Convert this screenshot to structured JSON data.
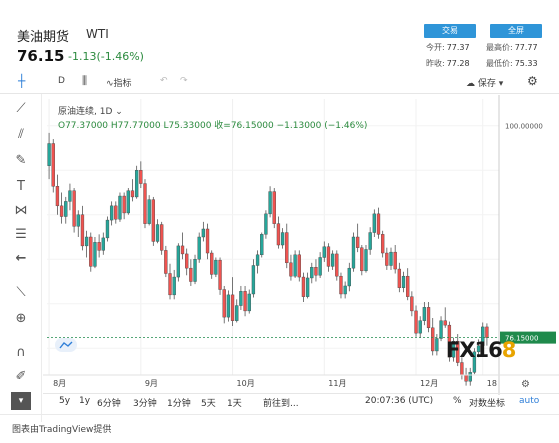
{
  "header": {
    "name": "美油期货",
    "symbol": "WTI",
    "price": "76.15",
    "change": "-1.13(-1.46%)",
    "trade_label": "交易",
    "fullscreen_label": "全屏",
    "stats": [
      {
        "label": "今开:",
        "value": "77.37"
      },
      {
        "label": "最高价:",
        "value": "77.77"
      },
      {
        "label": "昨收:",
        "value": "77.28"
      },
      {
        "label": "最低价:",
        "value": "75.33"
      }
    ]
  },
  "toolbar": {
    "interval": "D",
    "indicators_label": "指标",
    "save_label": "保存"
  },
  "legend": {
    "series": "原油连续, 1D",
    "ohlc": "O77.37000  H77.77000  L75.33000  收=76.15000  −1.13000 (−1.46%)"
  },
  "watermark": {
    "text_a": "FX16",
    "text_b": "8"
  },
  "bottom_bar": {
    "ranges": [
      "5y",
      "1y",
      "6分钟",
      "3分钟",
      "1分钟",
      "5天",
      "1天"
    ],
    "goto_label": "前往到...",
    "time": "20:07:36 (UTC)",
    "percent_label": "%",
    "log_label": "对数坐标",
    "auto_label": "auto"
  },
  "footer": {
    "text": "图表由TradingView提供"
  },
  "colors": {
    "up": "#26a69a",
    "down": "#ef5350",
    "line": "#1f8a4c",
    "accent": "#2f95d8"
  },
  "chart_data": {
    "type": "candlestick",
    "title": "原油连续, 1D",
    "x_tick_labels": [
      "8月",
      "9月",
      "10月",
      "11月",
      "12月",
      "18"
    ],
    "y_tick_labels": [
      "100.00000"
    ],
    "last_price_label": "76.15000",
    "ylim": [
      72,
      103
    ],
    "grid": true,
    "series": [
      {
        "name": "原油连续",
        "values": [
          [
            95.5,
            99.2,
            94.0,
            98.0
          ],
          [
            98.0,
            98.5,
            92.5,
            93.2
          ],
          [
            93.2,
            94.5,
            90.0,
            91.0
          ],
          [
            91.0,
            92.5,
            89.0,
            89.8
          ],
          [
            89.8,
            92.0,
            89.0,
            91.5
          ],
          [
            91.5,
            93.5,
            90.5,
            92.7
          ],
          [
            92.7,
            93.0,
            88.0,
            88.7
          ],
          [
            88.7,
            90.5,
            87.5,
            90.0
          ],
          [
            90.0,
            91.0,
            86.0,
            86.5
          ],
          [
            86.5,
            88.2,
            85.2,
            87.5
          ],
          [
            87.5,
            88.0,
            83.6,
            84.2
          ],
          [
            84.2,
            87.5,
            84.0,
            86.9
          ],
          [
            86.9,
            87.8,
            85.2,
            86.0
          ],
          [
            86.0,
            88.0,
            85.5,
            87.4
          ],
          [
            87.4,
            89.8,
            87.0,
            89.4
          ],
          [
            89.4,
            91.5,
            88.8,
            91.0
          ],
          [
            91.0,
            91.5,
            89.0,
            89.5
          ],
          [
            89.5,
            92.5,
            89.2,
            92.1
          ],
          [
            92.1,
            92.5,
            89.5,
            90.2
          ],
          [
            90.2,
            93.0,
            90.0,
            92.7
          ],
          [
            92.7,
            94.0,
            91.5,
            92.0
          ],
          [
            92.0,
            95.5,
            91.8,
            95.0
          ],
          [
            95.0,
            96.0,
            93.0,
            93.5
          ],
          [
            93.5,
            94.0,
            88.5,
            89.0
          ],
          [
            89.0,
            92.2,
            88.8,
            91.7
          ],
          [
            91.7,
            92.0,
            86.5,
            87.0
          ],
          [
            87.0,
            89.5,
            86.8,
            88.9
          ],
          [
            88.9,
            89.2,
            85.5,
            86.0
          ],
          [
            86.0,
            86.5,
            83.0,
            83.4
          ],
          [
            83.4,
            84.5,
            80.5,
            81.0
          ],
          [
            81.0,
            83.8,
            80.5,
            83.0
          ],
          [
            83.0,
            86.8,
            82.5,
            86.5
          ],
          [
            86.5,
            88.0,
            85.0,
            85.6
          ],
          [
            85.6,
            86.2,
            83.2,
            84.0
          ],
          [
            84.0,
            85.0,
            82.0,
            82.5
          ],
          [
            82.5,
            85.5,
            82.2,
            85.0
          ],
          [
            85.0,
            88.0,
            84.6,
            87.5
          ],
          [
            87.5,
            89.2,
            87.0,
            88.4
          ],
          [
            88.4,
            89.0,
            85.0,
            85.7
          ],
          [
            85.7,
            86.0,
            82.8,
            83.3
          ],
          [
            83.3,
            85.2,
            83.0,
            84.9
          ],
          [
            84.9,
            85.2,
            81.0,
            81.6
          ],
          [
            81.6,
            82.0,
            77.8,
            78.5
          ],
          [
            78.5,
            81.5,
            78.0,
            81.0
          ],
          [
            81.0,
            83.0,
            77.5,
            78.1
          ],
          [
            78.1,
            80.5,
            77.9,
            79.8
          ],
          [
            79.8,
            82.0,
            79.3,
            81.4
          ],
          [
            81.4,
            82.0,
            78.6,
            79.2
          ],
          [
            79.2,
            81.6,
            78.9,
            81.1
          ],
          [
            81.1,
            85.0,
            80.7,
            84.3
          ],
          [
            84.3,
            86.0,
            83.4,
            85.5
          ],
          [
            85.5,
            88.0,
            85.2,
            87.8
          ],
          [
            87.8,
            90.5,
            87.3,
            90.1
          ],
          [
            90.1,
            93.2,
            89.7,
            92.6
          ],
          [
            92.6,
            93.0,
            88.5,
            89.0
          ],
          [
            89.0,
            89.8,
            86.2,
            86.6
          ],
          [
            86.6,
            88.5,
            86.2,
            88.0
          ],
          [
            88.0,
            89.0,
            84.0,
            84.6
          ],
          [
            84.6,
            85.5,
            82.6,
            83.1
          ],
          [
            83.1,
            86.0,
            82.9,
            85.5
          ],
          [
            85.5,
            86.0,
            82.5,
            83.0
          ],
          [
            83.0,
            83.5,
            80.2,
            80.8
          ],
          [
            80.8,
            83.5,
            80.6,
            82.9
          ],
          [
            82.9,
            84.6,
            82.3,
            84.1
          ],
          [
            84.1,
            85.0,
            82.5,
            83.2
          ],
          [
            83.2,
            85.8,
            82.9,
            85.2
          ],
          [
            85.2,
            87.0,
            84.7,
            86.4
          ],
          [
            86.4,
            86.8,
            83.6,
            84.2
          ],
          [
            84.2,
            86.0,
            83.8,
            85.6
          ],
          [
            85.6,
            86.0,
            82.6,
            83.1
          ],
          [
            83.1,
            83.5,
            80.6,
            81.1
          ],
          [
            81.1,
            82.5,
            80.6,
            82.0
          ],
          [
            82.0,
            84.6,
            81.4,
            84.0
          ],
          [
            84.0,
            88.0,
            83.6,
            87.5
          ],
          [
            87.5,
            89.0,
            85.8,
            86.3
          ],
          [
            86.3,
            86.6,
            83.2,
            83.7
          ],
          [
            83.7,
            86.6,
            83.5,
            86.1
          ],
          [
            86.1,
            88.6,
            85.5,
            88.0
          ],
          [
            88.0,
            90.6,
            87.5,
            90.1
          ],
          [
            90.1,
            90.8,
            87.3,
            87.8
          ],
          [
            87.8,
            88.2,
            85.2,
            85.7
          ],
          [
            85.7,
            86.3,
            83.8,
            84.3
          ],
          [
            84.3,
            86.3,
            83.8,
            85.8
          ],
          [
            85.8,
            86.6,
            83.4,
            83.9
          ],
          [
            83.9,
            84.6,
            81.3,
            81.8
          ],
          [
            81.8,
            83.6,
            81.3,
            83.1
          ],
          [
            83.1,
            84.0,
            80.4,
            80.8
          ],
          [
            80.8,
            81.4,
            78.6,
            79.2
          ],
          [
            79.2,
            79.8,
            76.3,
            76.7
          ],
          [
            76.7,
            78.6,
            76.2,
            78.1
          ],
          [
            78.1,
            80.2,
            77.6,
            79.6
          ],
          [
            79.6,
            80.2,
            76.8,
            77.3
          ],
          [
            77.3,
            78.4,
            74.2,
            74.7
          ],
          [
            74.7,
            76.6,
            74.2,
            76.1
          ],
          [
            76.1,
            78.6,
            75.8,
            78.1
          ],
          [
            78.1,
            79.6,
            77.3,
            77.6
          ],
          [
            77.6,
            78.0,
            73.5,
            74.0
          ],
          [
            74.0,
            76.2,
            73.5,
            75.8
          ],
          [
            75.8,
            76.6,
            73.0,
            73.4
          ],
          [
            73.4,
            74.0,
            71.5,
            72.0
          ],
          [
            72.0,
            72.8,
            70.8,
            71.3
          ],
          [
            71.3,
            72.8,
            70.8,
            72.3
          ],
          [
            72.3,
            75.0,
            72.1,
            74.6
          ],
          [
            74.6,
            76.0,
            74.0,
            75.3
          ],
          [
            75.3,
            77.9,
            75.1,
            77.4
          ],
          [
            77.4,
            77.8,
            75.3,
            76.2
          ]
        ]
      }
    ]
  }
}
